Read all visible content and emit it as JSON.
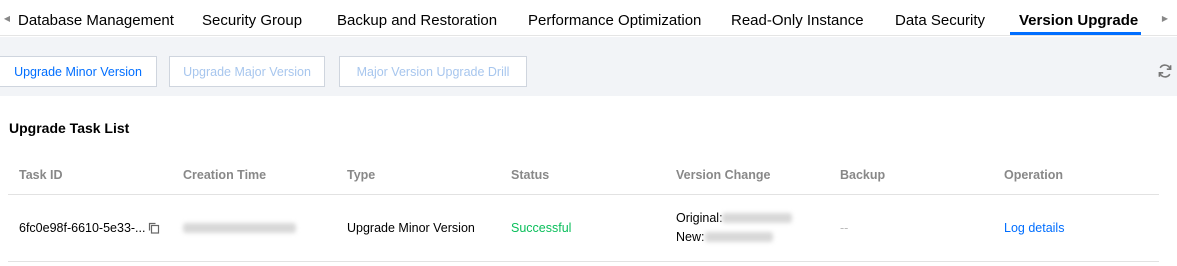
{
  "tabs": [
    {
      "label": "Database Management",
      "active": false
    },
    {
      "label": "Security Group",
      "active": false
    },
    {
      "label": "Backup and Restoration",
      "active": false
    },
    {
      "label": "Performance Optimization",
      "active": false
    },
    {
      "label": "Read-Only Instance",
      "active": false
    },
    {
      "label": "Data Security",
      "active": false
    },
    {
      "label": "Version Upgrade",
      "active": true
    }
  ],
  "toolbar": {
    "upgrade_minor": "Upgrade Minor Version",
    "upgrade_major": "Upgrade Major Version",
    "upgrade_drill": "Major Version Upgrade Drill"
  },
  "section": {
    "title": "Upgrade Task List"
  },
  "table": {
    "columns": [
      "Task ID",
      "Creation Time",
      "Type",
      "Status",
      "Version Change",
      "Backup",
      "Operation"
    ],
    "rows": [
      {
        "task_id": "6fc0e98f-6610-5e33-...",
        "type": "Upgrade Minor Version",
        "status": "Successful",
        "version_original_label": "Original:",
        "version_new_label": "New:",
        "backup": "--",
        "operation": "Log details"
      }
    ]
  },
  "colors": {
    "accent": "#006eff",
    "success": "#0abf5b",
    "toolbar_bg": "#f2f4f7"
  },
  "icons": [
    "chevron-left-icon",
    "chevron-right-icon",
    "refresh-icon",
    "copy-icon"
  ]
}
